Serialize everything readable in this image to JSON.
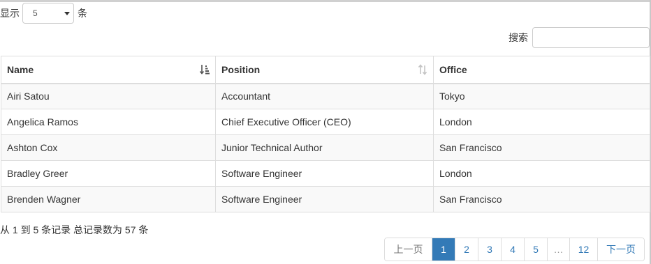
{
  "length": {
    "prefix": "显示",
    "value": "5",
    "suffix": "条"
  },
  "filter": {
    "label": "搜索",
    "value": "",
    "placeholder": ""
  },
  "table": {
    "headers": [
      "Name",
      "Position",
      "Office"
    ],
    "sort": {
      "name": "ascending",
      "position": "sortable",
      "office": "none"
    },
    "rows": [
      {
        "name": "Airi Satou",
        "position": "Accountant",
        "office": "Tokyo"
      },
      {
        "name": "Angelica Ramos",
        "position": "Chief Executive Officer (CEO)",
        "office": "London"
      },
      {
        "name": "Ashton Cox",
        "position": "Junior Technical Author",
        "office": "San Francisco"
      },
      {
        "name": "Bradley Greer",
        "position": "Software Engineer",
        "office": "London"
      },
      {
        "name": "Brenden Wagner",
        "position": "Software Engineer",
        "office": "San Francisco"
      }
    ]
  },
  "info": "从 1 到 5 条记录 总记录数为 57 条",
  "pagination": {
    "prev": "上一页",
    "pages": [
      "1",
      "2",
      "3",
      "4",
      "5"
    ],
    "ellipsis": "…",
    "last": "12",
    "next": "下一页",
    "active": "1"
  },
  "colors": {
    "accent": "#337ab7",
    "stripe": "#f9f9f9",
    "border": "#dddddd"
  }
}
